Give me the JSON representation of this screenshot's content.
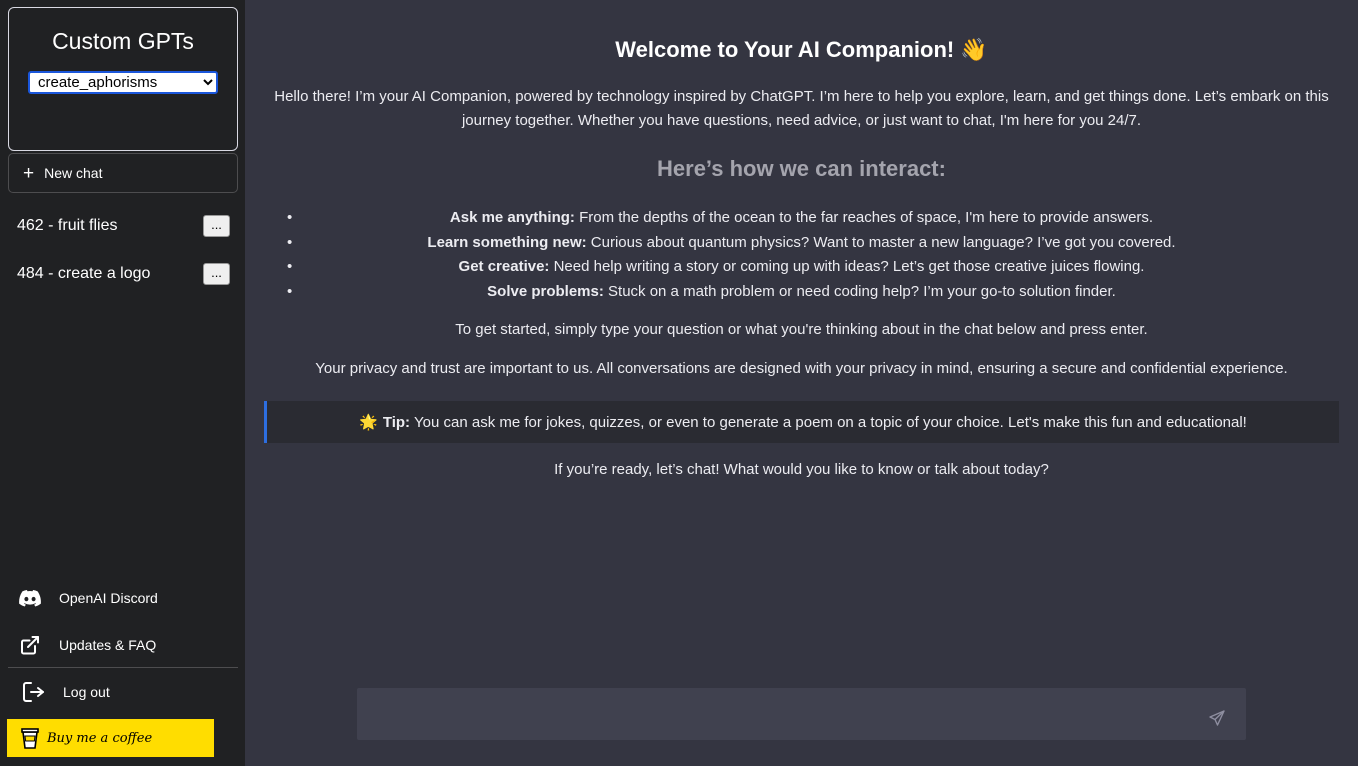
{
  "sidebar": {
    "title": "Custom GPTs",
    "selected_gpt": "create_aphorisms",
    "new_chat_label": "New chat",
    "chats": [
      {
        "label": "462 - fruit flies",
        "menu_label": "..."
      },
      {
        "label": "484 - create a logo",
        "menu_label": "..."
      }
    ],
    "links": {
      "discord": "OpenAI Discord",
      "updates": "Updates & FAQ",
      "logout": "Log out"
    },
    "coffee_label": "Buy me a coffee"
  },
  "main": {
    "welcome_title": "Welcome to Your AI Companion! 👋",
    "intro": "Hello there! I’m your AI Companion, powered by technology inspired by ChatGPT. I’m here to help you explore, learn, and get things done. Let’s embark on this journey together. Whether you have questions, need advice, or just want to chat, I'm here for you 24/7.",
    "how_heading": "Here’s how we can interact:",
    "features": [
      {
        "title": "Ask me anything:",
        "text": " From the depths of the ocean to the far reaches of space, I'm here to provide answers."
      },
      {
        "title": "Learn something new:",
        "text": " Curious about quantum physics? Want to master a new language? I’ve got you covered."
      },
      {
        "title": "Get creative:",
        "text": " Need help writing a story or coming up with ideas? Let’s get those creative juices flowing."
      },
      {
        "title": "Solve problems:",
        "text": " Stuck on a math problem or need coding help? I’m your go-to solution finder."
      }
    ],
    "get_started": "To get started, simply type your question or what you're thinking about in the chat below and press enter.",
    "privacy": "Your privacy and trust are important to us. All conversations are designed with your privacy in mind, ensuring a secure and confidential experience.",
    "tip": {
      "icon": "🌟",
      "label": "Tip:",
      "text": "You can ask me for jokes, quizzes, or even to generate a poem on a topic of your choice. Let's make this fun and educational!"
    },
    "ready": "If you’re ready, let’s chat! What would you like to know or talk about today?",
    "input_value": ""
  },
  "colors": {
    "sidebar_bg": "#202123",
    "main_bg": "#343541",
    "input_bg": "#40414f",
    "tip_bg": "#2a2b32",
    "tip_accent": "#2d6ee0",
    "coffee_bg": "#ffdd00"
  }
}
